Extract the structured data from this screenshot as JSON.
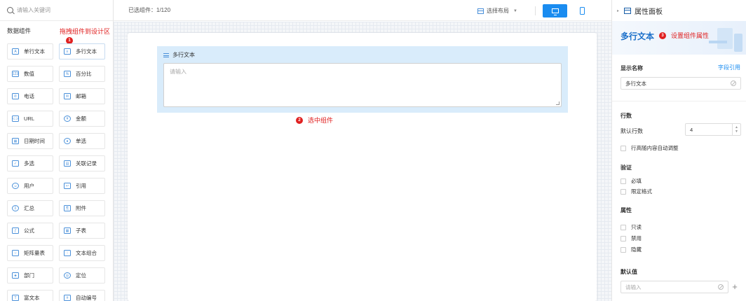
{
  "left": {
    "search_placeholder": "请输入关键词",
    "section_title": "数据组件",
    "drag_hint": "拖拽组件到设计区",
    "drag_hint_badge": "1",
    "components": [
      {
        "label": "单行文本",
        "icon": "text-a-icon",
        "glyph": "A"
      },
      {
        "label": "多行文本",
        "icon": "multiline-text-icon",
        "glyph": "≡"
      },
      {
        "label": "数值",
        "icon": "number-icon",
        "glyph": "123"
      },
      {
        "label": "百分比",
        "icon": "percent-icon",
        "glyph": "%"
      },
      {
        "label": "电话",
        "icon": "phone-icon",
        "glyph": "✆"
      },
      {
        "label": "邮箱",
        "icon": "mail-icon",
        "glyph": "✉"
      },
      {
        "label": "URL",
        "icon": "link-icon",
        "glyph": "⊂⊃"
      },
      {
        "label": "金额",
        "icon": "money-icon",
        "glyph": "¥"
      },
      {
        "label": "日期时间",
        "icon": "calendar-icon",
        "glyph": "▦"
      },
      {
        "label": "单选",
        "icon": "radio-icon",
        "glyph": "●"
      },
      {
        "label": "多选",
        "icon": "checkbox-icon",
        "glyph": "✓"
      },
      {
        "label": "关联记录",
        "icon": "relation-icon",
        "glyph": "▤"
      },
      {
        "label": "用户",
        "icon": "user-icon",
        "glyph": "☺"
      },
      {
        "label": "引用",
        "icon": "reference-icon",
        "glyph": "↩"
      },
      {
        "label": "汇总",
        "icon": "summary-icon",
        "glyph": "Σ"
      },
      {
        "label": "附件",
        "icon": "attachment-icon",
        "glyph": "⎘"
      },
      {
        "label": "公式",
        "icon": "formula-icon",
        "glyph": "ƒ"
      },
      {
        "label": "子表",
        "icon": "subtable-icon",
        "glyph": "▦"
      },
      {
        "label": "矩阵量表",
        "icon": "star-icon",
        "glyph": "☆"
      },
      {
        "label": "文本组合",
        "icon": "text-combo-icon",
        "glyph": "⁝"
      },
      {
        "label": "部门",
        "icon": "org-icon",
        "glyph": "♣"
      },
      {
        "label": "定位",
        "icon": "location-icon",
        "glyph": "◎"
      },
      {
        "label": "富文本",
        "icon": "richtext-icon",
        "glyph": "T"
      },
      {
        "label": "自动编号",
        "icon": "autonumber-icon",
        "glyph": "#"
      }
    ]
  },
  "toolbar": {
    "selected_count": "已选组件：1/120",
    "layout_label": "选择布局",
    "layout_caret": "▼"
  },
  "canvas": {
    "field_label": "多行文本",
    "textarea_placeholder": "请输入",
    "select_hint": "选中组件",
    "select_hint_badge": "2"
  },
  "panel": {
    "title": "属性面板",
    "collapse_arrow": "▸",
    "component_name": "多行文本",
    "set_props_hint": "设置组件属性",
    "set_props_badge": "3",
    "display_name_label": "显示名称",
    "field_ref_link": "字段引用",
    "display_name_value": "多行文本",
    "rows_section": "行数",
    "default_rows_label": "默认行数",
    "default_rows_value": "4",
    "spin_up": "▲",
    "spin_down": "▼",
    "auto_height_label": "行高随内容自动调整",
    "validation_section": "验证",
    "required_label": "必填",
    "format_label": "限定格式",
    "attribute_section": "属性",
    "readonly_label": "只读",
    "disabled_label": "禁用",
    "hidden_label": "隐藏",
    "default_value_section": "默认值",
    "default_value_placeholder": "请输入",
    "add_symbol": "+"
  },
  "colors": {
    "accent": "#1a8cf0",
    "annotation_red": "#e02020",
    "selection_bg": "#d9ecfb"
  }
}
